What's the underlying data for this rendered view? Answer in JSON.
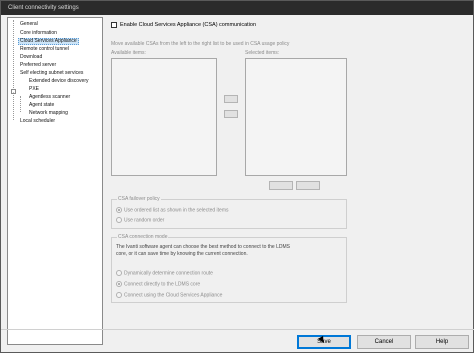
{
  "window": {
    "title": "Client connectivity settings"
  },
  "tree": {
    "items": [
      {
        "label": "General"
      },
      {
        "label": "Core information"
      },
      {
        "label": "Cloud Services Appliance"
      },
      {
        "label": "Remote control tunnel"
      },
      {
        "label": "Download"
      },
      {
        "label": "Preferred server"
      },
      {
        "label": "Self electing subnet services"
      },
      {
        "label": "Extended device discovery"
      },
      {
        "label": "PXE"
      },
      {
        "label": "Agentless scanner"
      },
      {
        "label": "Agent state"
      },
      {
        "label": "Network mapping"
      },
      {
        "label": "Local scheduler"
      }
    ],
    "expander": "-"
  },
  "csa": {
    "enable_label": "Enable Cloud Services Appliance (CSA) communication",
    "enabled": false,
    "instructions": "Move available CSAs from the left to the right list to be used in CSA usage policy",
    "available_label": "Available items:",
    "selected_label": "Selected items:",
    "failover": {
      "group_label": "CSA failover policy",
      "options": [
        {
          "label": "Use ordered list as shown in the selected items",
          "selected": true
        },
        {
          "label": "Use random order",
          "selected": false
        }
      ]
    },
    "connection_mode": {
      "group_label": "CSA connection mode",
      "description_line1": "The Ivanti software agent can choose the best method to connect to the LDMS",
      "description_line2": "core, or it can save time by knowing the current connection.",
      "options": [
        {
          "label": "Dynamically determine connection route",
          "selected": false
        },
        {
          "label": "Connect directly to the LDMS core",
          "selected": true
        },
        {
          "label": "Connect using the Cloud Services Appliance",
          "selected": false
        }
      ]
    }
  },
  "footer": {
    "save_label": "Save",
    "cancel_label": "Cancel",
    "help_label": "Help"
  }
}
